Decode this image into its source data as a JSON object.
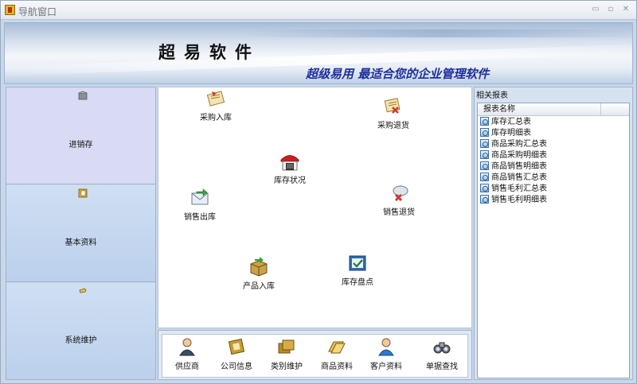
{
  "window": {
    "title": "导航窗口",
    "minimize": "▭",
    "maximize": "▫",
    "close": "✕"
  },
  "banner": {
    "brand": "超易软件",
    "slogan": "超级易用 最适合您的企业管理软件"
  },
  "left_nav": {
    "items": [
      {
        "label": "进销存",
        "icon": "box-icon",
        "active": true
      },
      {
        "label": "基本资料",
        "icon": "notebook-icon",
        "active": false
      },
      {
        "label": "系统维护",
        "icon": "wrench-icon",
        "active": false
      }
    ]
  },
  "workspace": {
    "items": [
      {
        "label": "采购入库",
        "icon": "purchase-in-icon"
      },
      {
        "label": "采购退货",
        "icon": "purchase-return-icon"
      },
      {
        "label": "库存状况",
        "icon": "warehouse-icon"
      },
      {
        "label": "销售出库",
        "icon": "sales-out-icon"
      },
      {
        "label": "销售退货",
        "icon": "sales-return-icon"
      },
      {
        "label": "产品入库",
        "icon": "product-in-icon"
      },
      {
        "label": "库存盘点",
        "icon": "stocktake-icon"
      }
    ]
  },
  "quick_bar": {
    "items": [
      {
        "label": "供应商",
        "icon": "person-icon"
      },
      {
        "label": "公司信息",
        "icon": "book-icon"
      },
      {
        "label": "类别维护",
        "icon": "books-icon"
      },
      {
        "label": "商品资料",
        "icon": "folder-icon"
      },
      {
        "label": "客户资料",
        "icon": "customer-icon"
      },
      {
        "label": "单据查找",
        "icon": "binoculars-icon"
      }
    ]
  },
  "reports": {
    "title": "相关报表",
    "column_header": "报表名称",
    "items": [
      "库存汇总表",
      "库存明细表",
      "商品采购汇总表",
      "商品采购明细表",
      "商品销售明细表",
      "商品销售汇总表",
      "销售毛利汇总表",
      "销售毛利明细表"
    ]
  }
}
